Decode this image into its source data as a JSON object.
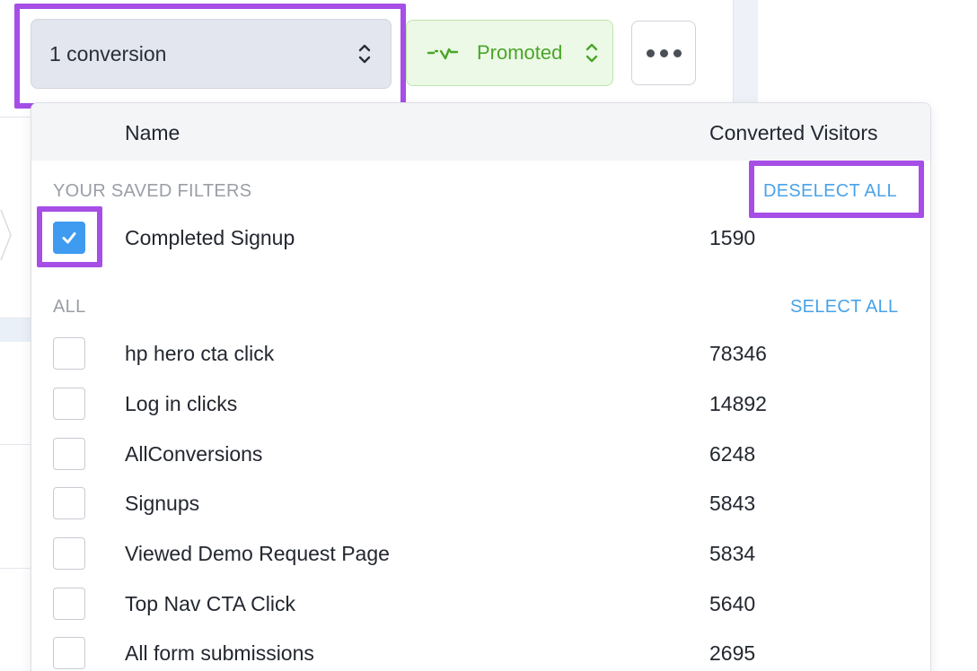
{
  "toolbar": {
    "conversion_select_label": "1 conversion",
    "promoted_label": "Promoted",
    "more_icon": "ellipsis-icon"
  },
  "dropdown": {
    "columns": {
      "name": "Name",
      "converted": "Converted Visitors"
    },
    "saved_section": {
      "label": "YOUR SAVED FILTERS",
      "action": "DESELECT ALL",
      "items": [
        {
          "name": "Completed Signup",
          "count": "1590",
          "checked": true
        }
      ]
    },
    "all_section": {
      "label": "ALL",
      "action": "SELECT ALL",
      "items": [
        {
          "name": "hp hero cta click",
          "count": "78346",
          "checked": false
        },
        {
          "name": "Log in clicks",
          "count": "14892",
          "checked": false
        },
        {
          "name": "AllConversions",
          "count": "6248",
          "checked": false
        },
        {
          "name": "Signups",
          "count": "5843",
          "checked": false
        },
        {
          "name": "Viewed Demo Request Page",
          "count": "5834",
          "checked": false
        },
        {
          "name": "Top Nav CTA Click",
          "count": "5640",
          "checked": false
        },
        {
          "name": "All form submissions",
          "count": "2695",
          "checked": false
        }
      ]
    }
  },
  "colors": {
    "highlight": "#a64ee6",
    "accent_blue": "#4aa3e8",
    "checkbox_blue": "#3e9bf0",
    "promoted_green": "#4aa52a"
  }
}
